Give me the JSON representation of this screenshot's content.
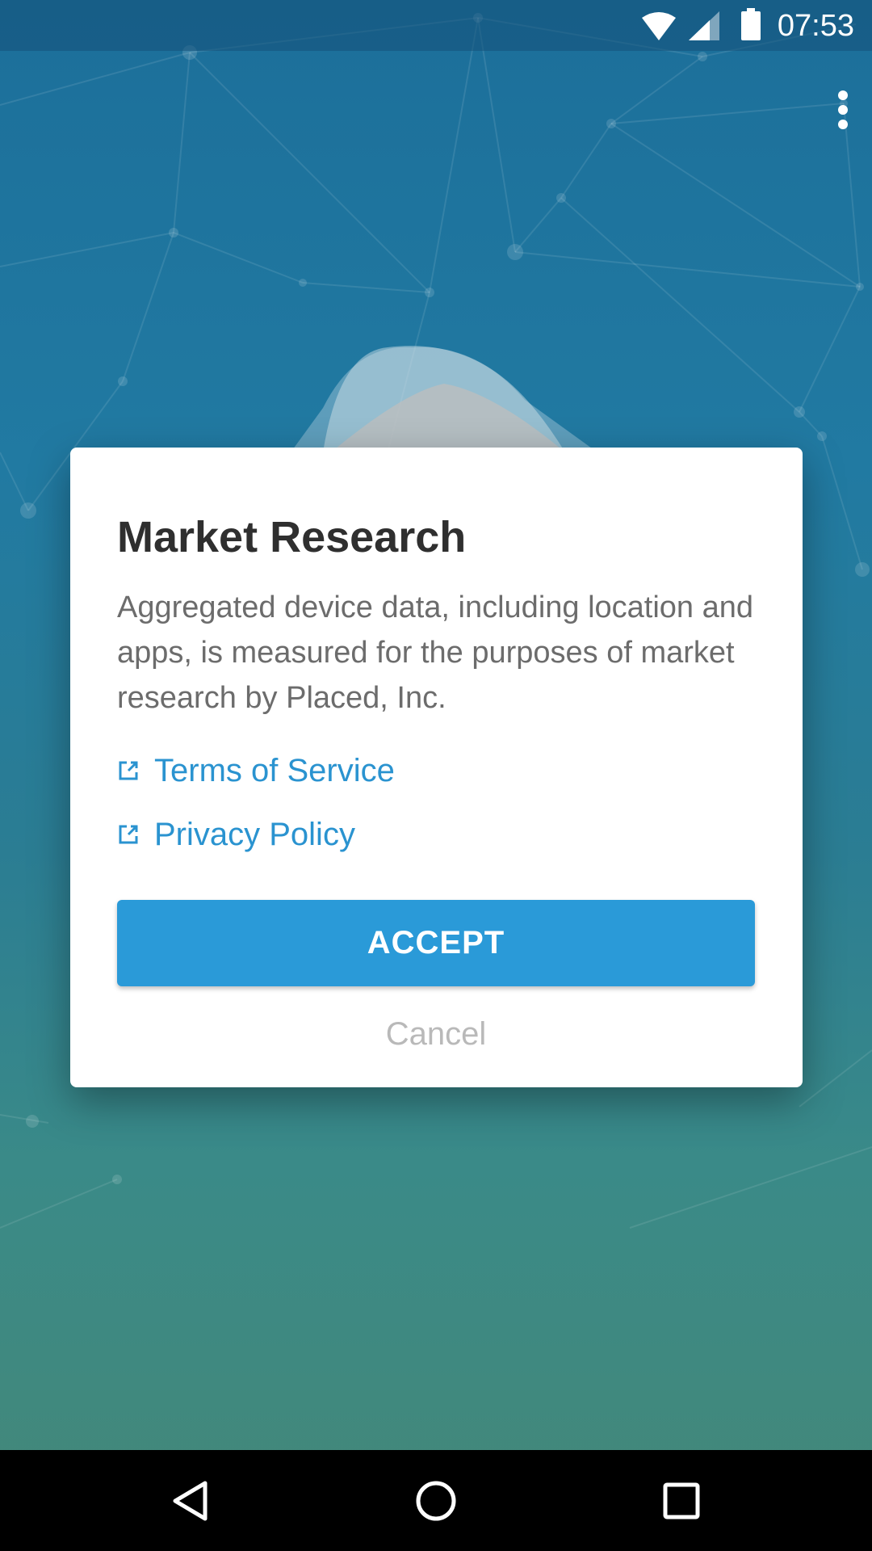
{
  "status_bar": {
    "time": "07:53",
    "icons": [
      "wifi-icon",
      "cellular-signal-icon",
      "battery-icon"
    ]
  },
  "app_bar": {
    "overflow_icon": "more-vert-icon"
  },
  "dialog": {
    "title": "Market Research",
    "body": "Aggregated device data, including location and apps, is measured for the purposes of market research by Placed, Inc.",
    "links": [
      {
        "label": "Terms of Service",
        "icon": "external-link-icon"
      },
      {
        "label": "Privacy Policy",
        "icon": "external-link-icon"
      }
    ],
    "accept_label": "ACCEPT",
    "cancel_label": "Cancel"
  },
  "nav_bar": {
    "buttons": [
      "back-icon",
      "home-icon",
      "recents-icon"
    ]
  },
  "colors": {
    "accent": "#2a9ad8",
    "link": "#2a93d0",
    "background_top": "#1c6f9a",
    "background_bottom": "#448878"
  }
}
